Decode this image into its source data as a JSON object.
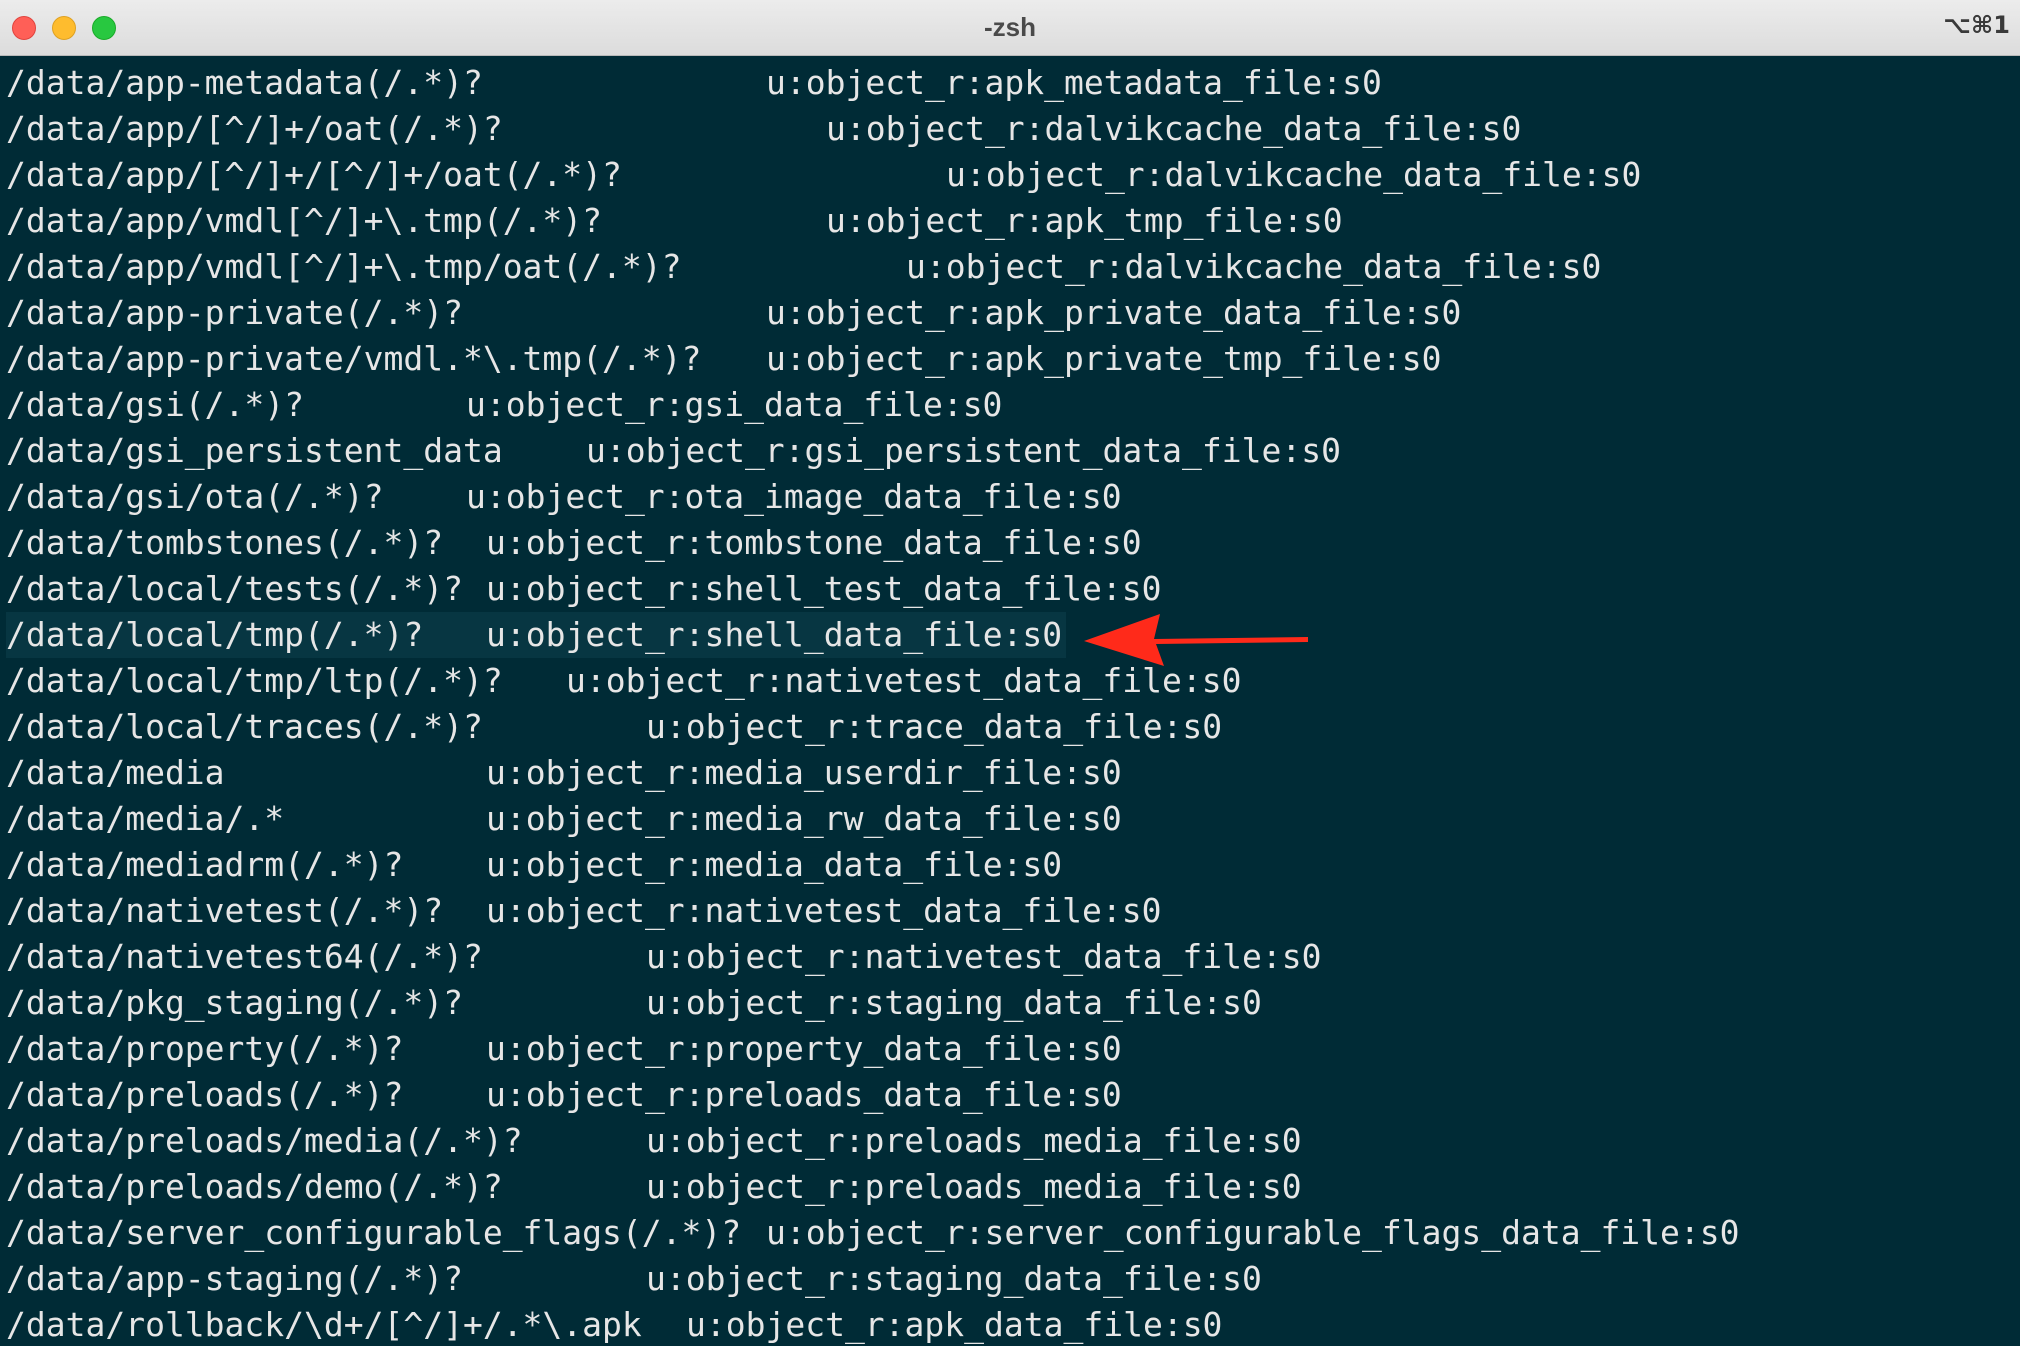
{
  "window": {
    "title": "-zsh",
    "shortcut": "⌥⌘1",
    "colors": {
      "background": "#002b36",
      "highlight": "#073642",
      "text": "#e6e6e6",
      "arrow": "#ff2a1a"
    }
  },
  "terminal": {
    "lines": [
      {
        "path": "/data/app-metadata(/.*)?",
        "context": "u:object_r:apk_metadata_file:s0"
      },
      {
        "path": "/data/app/[^/]+/oat(/.*)?",
        "context": "u:object_r:dalvikcache_data_file:s0"
      },
      {
        "path": "/data/app/[^/]+/[^/]+/oat(/.*)?",
        "context": "u:object_r:dalvikcache_data_file:s0"
      },
      {
        "path": "/data/app/vmdl[^/]+\\.tmp(/.*)?",
        "context": "u:object_r:apk_tmp_file:s0"
      },
      {
        "path": "/data/app/vmdl[^/]+\\.tmp/oat(/.*)?",
        "context": "u:object_r:dalvikcache_data_file:s0"
      },
      {
        "path": "/data/app-private(/.*)?",
        "context": "u:object_r:apk_private_data_file:s0"
      },
      {
        "path": "/data/app-private/vmdl.*\\.tmp(/.*)?",
        "context": "u:object_r:apk_private_tmp_file:s0"
      },
      {
        "path": "/data/gsi(/.*)?",
        "context": "u:object_r:gsi_data_file:s0"
      },
      {
        "path": "/data/gsi_persistent_data",
        "context": "u:object_r:gsi_persistent_data_file:s0"
      },
      {
        "path": "/data/gsi/ota(/.*)?",
        "context": "u:object_r:ota_image_data_file:s0"
      },
      {
        "path": "/data/tombstones(/.*)?",
        "context": "u:object_r:tombstone_data_file:s0"
      },
      {
        "path": "/data/local/tests(/.*)?",
        "context": "u:object_r:shell_test_data_file:s0"
      },
      {
        "path": "/data/local/tmp(/.*)?",
        "context": "u:object_r:shell_data_file:s0"
      },
      {
        "path": "/data/local/tmp/ltp(/.*)?",
        "context": "u:object_r:nativetest_data_file:s0"
      },
      {
        "path": "/data/local/traces(/.*)?",
        "context": "u:object_r:trace_data_file:s0"
      },
      {
        "path": "/data/media",
        "context": "u:object_r:media_userdir_file:s0"
      },
      {
        "path": "/data/media/.*",
        "context": "u:object_r:media_rw_data_file:s0"
      },
      {
        "path": "/data/mediadrm(/.*)?",
        "context": "u:object_r:media_data_file:s0"
      },
      {
        "path": "/data/nativetest(/.*)?",
        "context": "u:object_r:nativetest_data_file:s0"
      },
      {
        "path": "/data/nativetest64(/.*)?",
        "context": "u:object_r:nativetest_data_file:s0"
      },
      {
        "path": "/data/pkg_staging(/.*)?",
        "context": "u:object_r:staging_data_file:s0"
      },
      {
        "path": "/data/property(/.*)?",
        "context": "u:object_r:property_data_file:s0"
      },
      {
        "path": "/data/preloads(/.*)?",
        "context": "u:object_r:preloads_data_file:s0"
      },
      {
        "path": "/data/preloads/media(/.*)?",
        "context": "u:object_r:preloads_media_file:s0"
      },
      {
        "path": "/data/preloads/demo(/.*)?",
        "context": "u:object_r:preloads_media_file:s0"
      },
      {
        "path": "/data/server_configurable_flags(/.*)?",
        "context": "u:object_r:server_configurable_flags_data_file:s0"
      },
      {
        "path": "/data/app-staging(/.*)?",
        "context": "u:object_r:staging_data_file:s0"
      },
      {
        "path": "/data/rollback/\\d+/[^/]+/.*\\.apk",
        "context": "u:object_r:apk_data_file:s0"
      }
    ]
  }
}
